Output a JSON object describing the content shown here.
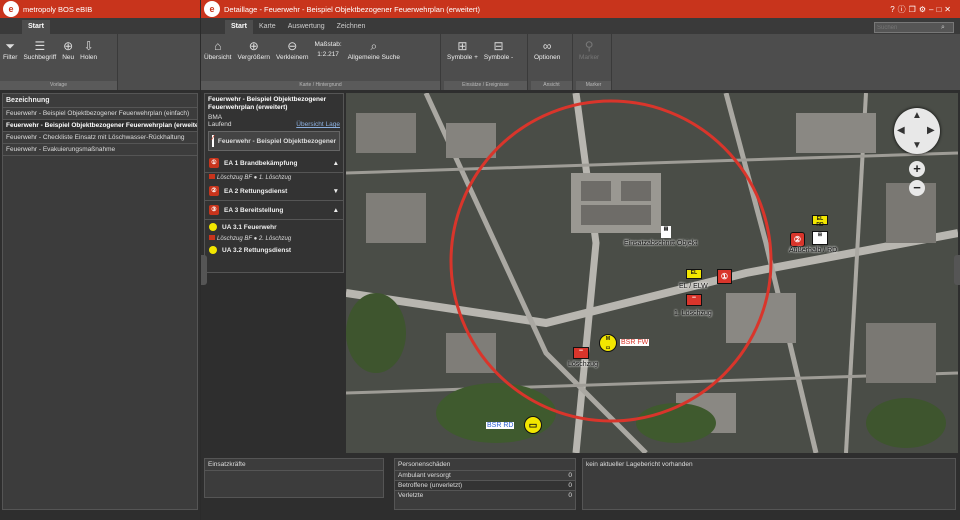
{
  "left_window": {
    "title": "metropoly BOS eBIB",
    "tab": "Start",
    "group_label": "Vorlage",
    "buttons": [
      {
        "label": "Filter",
        "icon": "filter-icon"
      },
      {
        "label": "Suchbegriff",
        "icon": "list-icon"
      },
      {
        "label": "Neu",
        "icon": "add-circle-icon"
      },
      {
        "label": "Holen",
        "icon": "import-icon"
      }
    ],
    "list_header": "Bezeichnung",
    "list_items": [
      "Feuerwehr - Beispiel Objektbezogener Feuerwehrplan (einfach)",
      "Feuerwehr - Beispiel Objektbezogener Feuerwehrplan (erweitert)",
      "Feuerwehr - Checkliste Einsatz mit Löschwasser-Rückhaltung",
      "Feuerwehr - Evakuierungsmaßnahme"
    ],
    "selected_index": 1
  },
  "right_window": {
    "title": "Detaillage - Feuerwehr - Beispiel Objektbezogener Feuerwehrplan (erweitert)",
    "tabs": [
      "Start",
      "Karte",
      "Auswertung",
      "Zeichnen"
    ],
    "active_tab": "Start",
    "search_placeholder": "Suchen",
    "groups": [
      {
        "label": "Karte / Hintergrund",
        "buttons": [
          {
            "label": "Übersicht",
            "icon": "home-icon"
          },
          {
            "label": "Vergrößern",
            "icon": "zoom-in-icon"
          },
          {
            "label": "Verkleinern",
            "icon": "zoom-out-icon"
          }
        ]
      },
      {
        "label": "Einsätze / Ereignisse",
        "buttons": [
          {
            "label": "Symbole +",
            "icon": "plus-box-icon"
          },
          {
            "label": "Symbole -",
            "icon": "minus-box-icon"
          }
        ]
      },
      {
        "label": "Ansicht",
        "buttons": [
          {
            "label": "Optionen",
            "icon": "glasses-icon"
          }
        ]
      },
      {
        "label": "Marker",
        "buttons": [
          {
            "label": "Marker",
            "icon": "pin-icon"
          }
        ]
      }
    ],
    "scale_label": "Maßstab:",
    "scale_value": "1:2.217",
    "general_search": "Allgemeine Suche"
  },
  "incident": {
    "title": "Feuerwehr - Beispiel Objektbezogener Feuerwehrplan (erweitert)",
    "type": "BMA",
    "status": "Laufend",
    "overview_link": "Übersicht Lage",
    "card_title": "Feuerwehr - Beispiel Objektbezogener",
    "sections": [
      {
        "label": "EA 1 Brandbekämpfung",
        "subs": [
          "Löschzug BF  ●  1. Löschzug"
        ]
      },
      {
        "label": "EA 2 Rettungsdienst",
        "subs": []
      },
      {
        "label": "EA 3 Bereitstellung",
        "subs": []
      }
    ],
    "ua": [
      {
        "label": "UA 3.1 Feuerwehr",
        "sub": "Löschzug BF  ●  2. Löschzug"
      },
      {
        "label": "UA 3.2 Rettungsdienst",
        "sub": ""
      }
    ]
  },
  "map": {
    "labels": {
      "ea_bb": "Einsatzabschnitt",
      "obj": "Objekt",
      "ausserhalb": "Außerhalb / RD",
      "el_elw": "EL / ELW",
      "lz1": "1. Löschzug",
      "lz2": "Löschzug",
      "bsr_fw": "BSR FW",
      "bsr_rd": "BSR RD",
      "el": "EL",
      "el_rd": "EL RD",
      "m": "M"
    },
    "colors": {
      "circle": "#d9352b",
      "accent": "#c8341c",
      "yellow": "#f2e600"
    }
  },
  "bottom": {
    "einsatzkraefte": "Einsatzkräfte",
    "personenschaeden": "Personenschäden",
    "rows": [
      {
        "label": "Ambulant versorgt",
        "value": "0"
      },
      {
        "label": "Betroffene (unverletzt)",
        "value": "0"
      },
      {
        "label": "Verletzte",
        "value": "0"
      }
    ],
    "lagebericht": "kein aktueller Lagebericht vorhanden"
  }
}
